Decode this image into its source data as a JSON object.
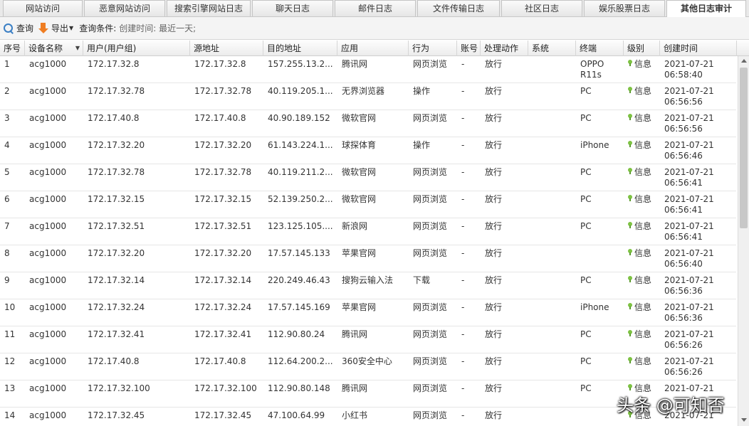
{
  "tabs": [
    {
      "label": "网站访问",
      "active": false
    },
    {
      "label": "恶意网站访问",
      "active": false
    },
    {
      "label": "搜索引擎网站日志",
      "active": false
    },
    {
      "label": "聊天日志",
      "active": false
    },
    {
      "label": "邮件日志",
      "active": false
    },
    {
      "label": "文件传输日志",
      "active": false
    },
    {
      "label": "社区日志",
      "active": false
    },
    {
      "label": "娱乐股票日志",
      "active": false
    },
    {
      "label": "其他日志审计",
      "active": true
    }
  ],
  "toolbar": {
    "query_label": "查询",
    "export_label": "导出",
    "condition_label": "查询条件:",
    "condition_value": "创建时间: 最近一天;"
  },
  "columns": [
    "序号",
    "设备名称",
    "用户(用户组)",
    "源地址",
    "目的地址",
    "应用",
    "行为",
    "账号",
    "处理动作",
    "系统",
    "终端",
    "级别",
    "创建时间"
  ],
  "rows": [
    {
      "no": "1",
      "device": "acg1000",
      "user": "172.17.32.8",
      "src": "172.17.32.8",
      "dst": "157.255.13.2...",
      "app": "腾讯网",
      "behavior": "网页浏览",
      "account": "-",
      "action": "放行",
      "system": "",
      "terminal": "OPPO R11s",
      "level": "信息",
      "date": "2021-07-21",
      "time": "06:58:40"
    },
    {
      "no": "2",
      "device": "acg1000",
      "user": "172.17.32.78",
      "src": "172.17.32.78",
      "dst": "40.119.205.1...",
      "app": "无界浏览器",
      "behavior": "操作",
      "account": "-",
      "action": "放行",
      "system": "",
      "terminal": "PC",
      "level": "信息",
      "date": "2021-07-21",
      "time": "06:56:56"
    },
    {
      "no": "3",
      "device": "acg1000",
      "user": "172.17.40.8",
      "src": "172.17.40.8",
      "dst": "40.90.189.152",
      "app": "微软官网",
      "behavior": "网页浏览",
      "account": "-",
      "action": "放行",
      "system": "",
      "terminal": "PC",
      "level": "信息",
      "date": "2021-07-21",
      "time": "06:56:56"
    },
    {
      "no": "4",
      "device": "acg1000",
      "user": "172.17.32.20",
      "src": "172.17.32.20",
      "dst": "61.143.224.1...",
      "app": "球探体育",
      "behavior": "操作",
      "account": "-",
      "action": "放行",
      "system": "",
      "terminal": "iPhone",
      "level": "信息",
      "date": "2021-07-21",
      "time": "06:56:46"
    },
    {
      "no": "5",
      "device": "acg1000",
      "user": "172.17.32.78",
      "src": "172.17.32.78",
      "dst": "40.119.211.2...",
      "app": "微软官网",
      "behavior": "网页浏览",
      "account": "-",
      "action": "放行",
      "system": "",
      "terminal": "PC",
      "level": "信息",
      "date": "2021-07-21",
      "time": "06:56:41"
    },
    {
      "no": "6",
      "device": "acg1000",
      "user": "172.17.32.15",
      "src": "172.17.32.15",
      "dst": "52.139.250.2...",
      "app": "微软官网",
      "behavior": "网页浏览",
      "account": "-",
      "action": "放行",
      "system": "",
      "terminal": "PC",
      "level": "信息",
      "date": "2021-07-21",
      "time": "06:56:41"
    },
    {
      "no": "7",
      "device": "acg1000",
      "user": "172.17.32.51",
      "src": "172.17.32.51",
      "dst": "123.125.105....",
      "app": "新浪网",
      "behavior": "网页浏览",
      "account": "-",
      "action": "放行",
      "system": "",
      "terminal": "PC",
      "level": "信息",
      "date": "2021-07-21",
      "time": "06:56:41"
    },
    {
      "no": "8",
      "device": "acg1000",
      "user": "172.17.32.20",
      "src": "172.17.32.20",
      "dst": "17.57.145.133",
      "app": "苹果官网",
      "behavior": "网页浏览",
      "account": "-",
      "action": "放行",
      "system": "",
      "terminal": "",
      "level": "信息",
      "date": "2021-07-21",
      "time": "06:56:40"
    },
    {
      "no": "9",
      "device": "acg1000",
      "user": "172.17.32.14",
      "src": "172.17.32.14",
      "dst": "220.249.46.43",
      "app": "搜狗云输入法",
      "behavior": "下载",
      "account": "-",
      "action": "放行",
      "system": "",
      "terminal": "PC",
      "level": "信息",
      "date": "2021-07-21",
      "time": "06:56:36"
    },
    {
      "no": "10",
      "device": "acg1000",
      "user": "172.17.32.24",
      "src": "172.17.32.24",
      "dst": "17.57.145.169",
      "app": "苹果官网",
      "behavior": "网页浏览",
      "account": "-",
      "action": "放行",
      "system": "",
      "terminal": "iPhone",
      "level": "信息",
      "date": "2021-07-21",
      "time": "06:56:36"
    },
    {
      "no": "11",
      "device": "acg1000",
      "user": "172.17.32.41",
      "src": "172.17.32.41",
      "dst": "112.90.80.24",
      "app": "腾讯网",
      "behavior": "网页浏览",
      "account": "-",
      "action": "放行",
      "system": "",
      "terminal": "PC",
      "level": "信息",
      "date": "2021-07-21",
      "time": "06:56:26"
    },
    {
      "no": "12",
      "device": "acg1000",
      "user": "172.17.40.8",
      "src": "172.17.40.8",
      "dst": "112.64.200.2...",
      "app": "360安全中心",
      "behavior": "网页浏览",
      "account": "-",
      "action": "放行",
      "system": "",
      "terminal": "PC",
      "level": "信息",
      "date": "2021-07-21",
      "time": "06:56:26"
    },
    {
      "no": "13",
      "device": "acg1000",
      "user": "172.17.32.100",
      "src": "172.17.32.100",
      "dst": "112.90.80.148",
      "app": "腾讯网",
      "behavior": "网页浏览",
      "account": "-",
      "action": "放行",
      "system": "",
      "terminal": "PC",
      "level": "信息",
      "date": "2021-07-21",
      "time": ""
    },
    {
      "no": "14",
      "device": "acg1000",
      "user": "172.17.32.45",
      "src": "172.17.32.45",
      "dst": "47.100.64.99",
      "app": "小红书",
      "behavior": "网页浏览",
      "account": "-",
      "action": "放行",
      "system": "",
      "terminal": "",
      "level": "信息",
      "date": "2021-07-21",
      "time": ""
    }
  ],
  "watermark": "头条 @可知否"
}
